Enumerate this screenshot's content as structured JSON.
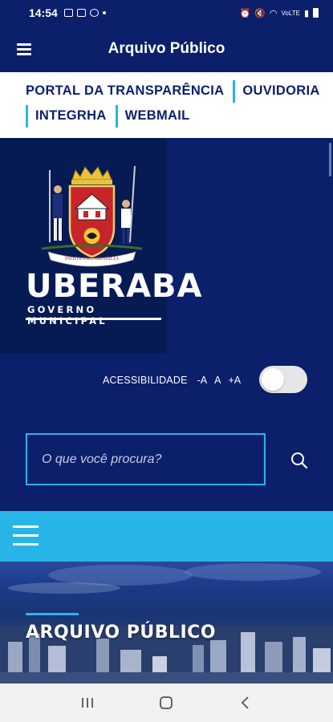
{
  "status_bar": {
    "time": "14:54",
    "signal_text": "VoLTE"
  },
  "app_bar": {
    "title": "Arquivo Público"
  },
  "top_links": {
    "row1": [
      "PORTAL DA TRANSPARÊNCIA",
      "OUVIDORIA"
    ],
    "row2": [
      "INTEGRHA",
      "WEBMAIL"
    ]
  },
  "logo": {
    "name": "UBERABA",
    "subtitle": "GOVERNO MUNICIPAL",
    "motto": "INDITE PRO BRASILIA"
  },
  "accessibility": {
    "label": "ACESSIBILIDADE",
    "decrease": "-A",
    "normal": "A",
    "increase": "+A",
    "toggle_on": false
  },
  "search": {
    "placeholder": "O que você procura?",
    "value": ""
  },
  "hero": {
    "title": "ARQUIVO PÚBLICO"
  },
  "colors": {
    "navy": "#0b1f6b",
    "dark_navy": "#061a54",
    "accent_cyan": "#27b5e8"
  },
  "icons": {
    "menu": "hamburger-icon",
    "search": "search-icon",
    "nav_recents": "recents-icon",
    "nav_home": "home-icon",
    "nav_back": "back-icon"
  }
}
